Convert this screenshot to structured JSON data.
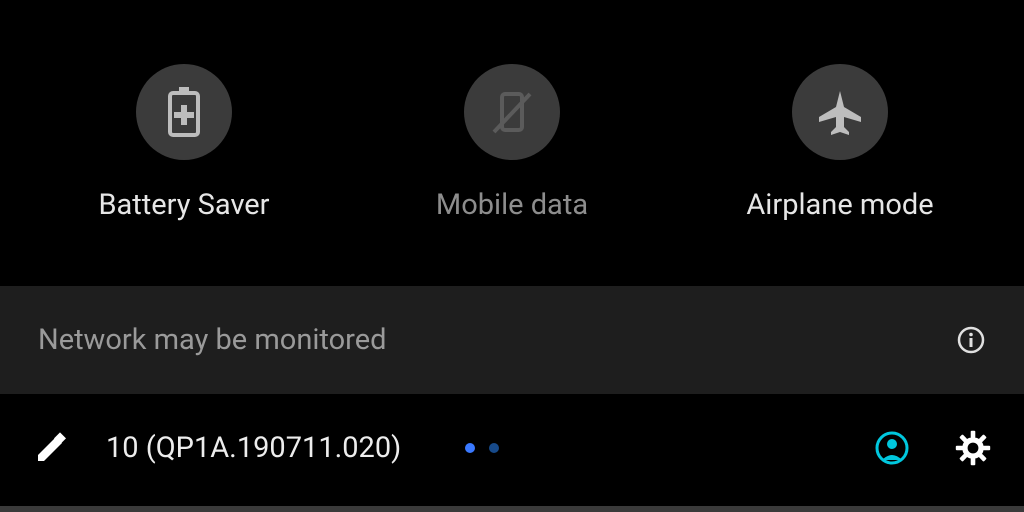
{
  "tiles": [
    {
      "label": "Battery Saver",
      "icon": "battery-saver-icon",
      "dim": false
    },
    {
      "label": "Mobile data",
      "icon": "mobile-data-off-icon",
      "dim": true
    },
    {
      "label": "Airplane mode",
      "icon": "airplane-icon",
      "dim": false
    }
  ],
  "notice": {
    "text": "Network may be monitored",
    "info_icon": "info-icon"
  },
  "footer": {
    "edit_icon": "edit-icon",
    "version_text": "10 (QP1A.190711.020)",
    "pager": {
      "dots": 2,
      "active_index": 0
    },
    "user_icon": "user-circle-icon",
    "settings_icon": "settings-icon"
  },
  "colors": {
    "accent_cyan": "#00c7de",
    "pager_active": "#3a79ff",
    "pager_inactive": "#174a8a"
  }
}
